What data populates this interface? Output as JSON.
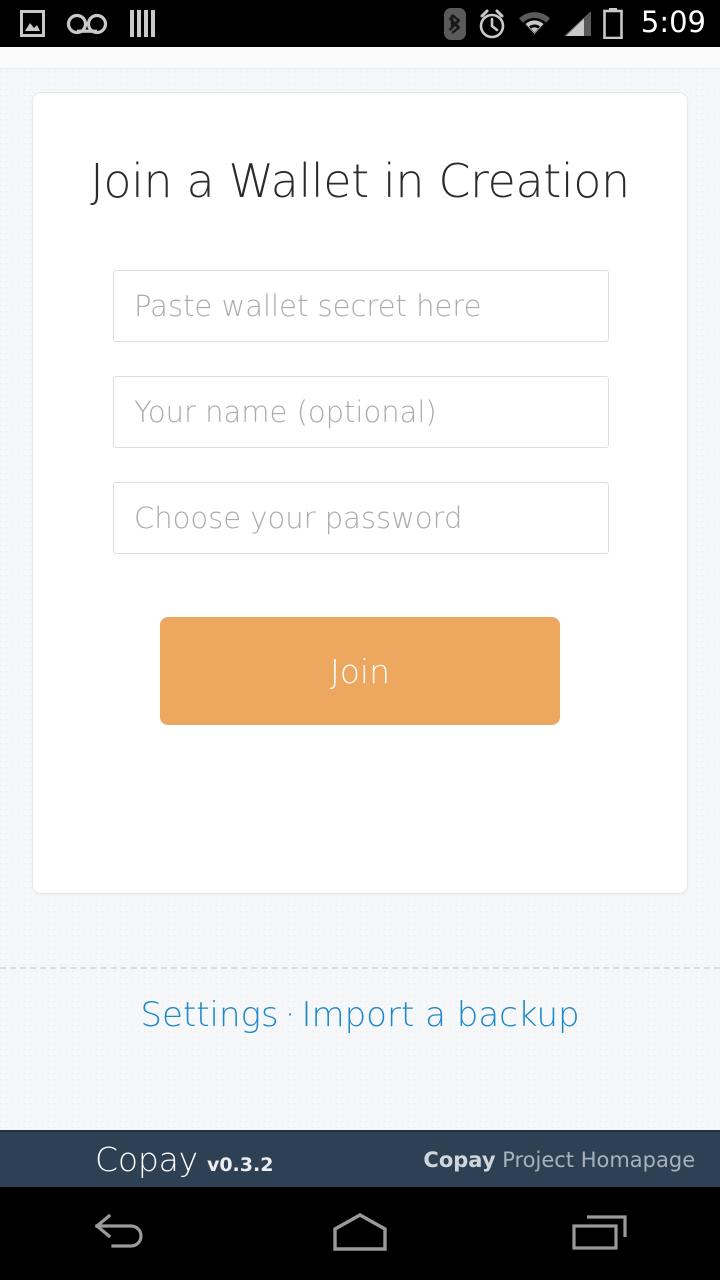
{
  "status_bar": {
    "icons_left": [
      "image-icon",
      "voicemail-icon",
      "sdcard-bars-icon"
    ],
    "icons_right": [
      "bluetooth-icon",
      "alarm-clock-icon",
      "wifi-icon",
      "cellular-signal-icon",
      "battery-charging-icon"
    ],
    "time": "5:09"
  },
  "card": {
    "title": "Join a Wallet in Creation",
    "fields": [
      {
        "name": "wallet-secret",
        "placeholder": "Paste wallet secret here",
        "value": ""
      },
      {
        "name": "your-name",
        "placeholder": "Your name (optional)",
        "value": ""
      },
      {
        "name": "password",
        "placeholder": "Choose your password",
        "value": ""
      }
    ],
    "join_label": "Join",
    "join_color": "#eda75f"
  },
  "links": {
    "settings_label": "Settings",
    "separator": "·",
    "import_label": "Import a backup",
    "color": "#1a87c9"
  },
  "footer": {
    "brand": "Copay",
    "version": "v0.3.2",
    "homepage_bold": "Copay",
    "homepage_rest": " Project Homapage",
    "background": "#2e4054"
  },
  "navbar": {
    "back_label": "back-icon",
    "home_label": "home-icon",
    "recents_label": "recents-icon"
  }
}
